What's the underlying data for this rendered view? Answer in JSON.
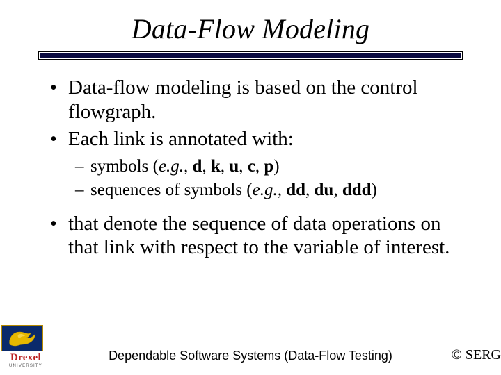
{
  "title": "Data-Flow Modeling",
  "bullets": {
    "b1": "Data-flow modeling is based on the control flowgraph.",
    "b2": "Each link is annotated with:",
    "b3": "that denote the sequence of data operations on that link with respect to the variable of interest."
  },
  "sub": {
    "s1_prefix": "symbols (",
    "s1_eg": "e.g.,",
    "s1_d": "d",
    "s1_k": "k",
    "s1_u": "u",
    "s1_c": "c",
    "s1_p": "p",
    "s1_close": ")",
    "s2_prefix": "sequences of symbols (",
    "s2_eg": "e.g.,",
    "s2_dd": "dd",
    "s2_du": "du",
    "s2_ddd": "ddd",
    "s2_close": ")",
    "comma": ", ",
    "space": " "
  },
  "footer": {
    "center": "Dependable Software Systems (Data-Flow Testing)",
    "right": "© SERG"
  },
  "logo": {
    "name": "Drexel",
    "sub": "UNIVERSITY"
  }
}
